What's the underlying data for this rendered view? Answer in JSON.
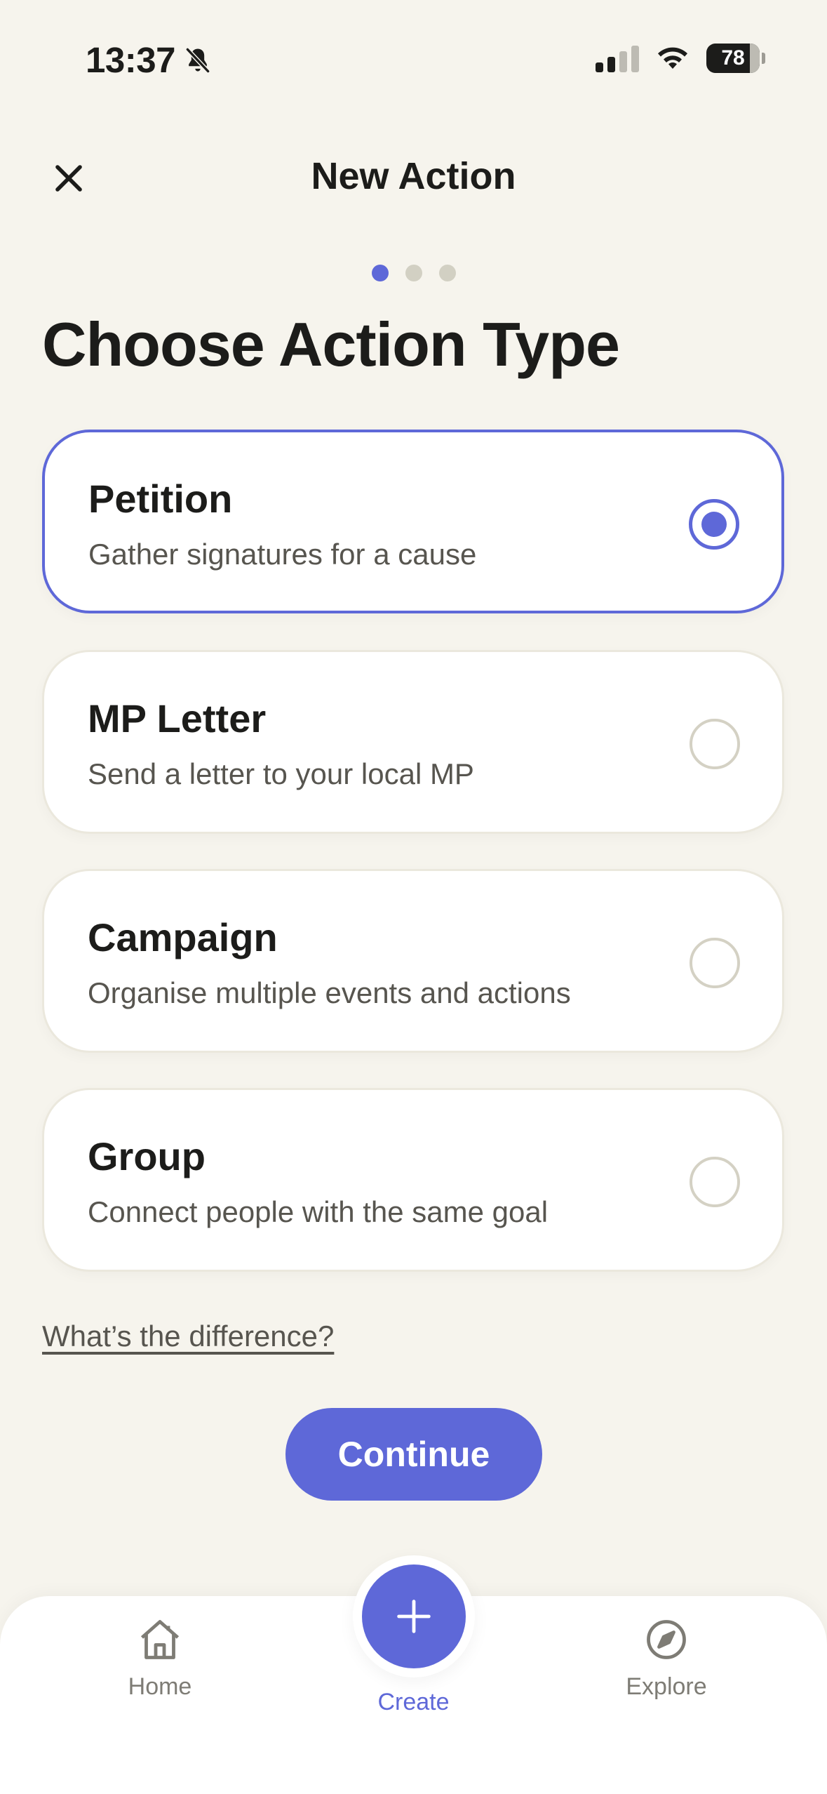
{
  "status_bar": {
    "time": "13:37",
    "battery": "78",
    "icons": [
      "bell-slash-icon",
      "signal-icon",
      "wifi-icon",
      "battery-icon"
    ]
  },
  "header": {
    "title": "New Action",
    "close_icon": "close-icon",
    "step_current": 1,
    "step_total": 3
  },
  "page": {
    "title": "Choose Action Type"
  },
  "options": [
    {
      "name": "Petition",
      "description": "Gather signatures for a cause",
      "selected": true
    },
    {
      "name": "MP Letter",
      "description": "Send a letter to your local MP",
      "selected": false
    },
    {
      "name": "Campaign",
      "description": "Organise multiple events and actions",
      "selected": false
    },
    {
      "name": "Group",
      "description": "Connect people with the same goal",
      "selected": false
    }
  ],
  "help_link": "What’s the difference?",
  "continue_label": "Continue",
  "tabbar": {
    "home": "Home",
    "create": "Create",
    "explore": "Explore"
  },
  "colors": {
    "accent": "#5e68d8",
    "background": "#f6f4ed",
    "card": "#ffffff",
    "text": "#1c1c1a",
    "muted": "#57554f"
  }
}
